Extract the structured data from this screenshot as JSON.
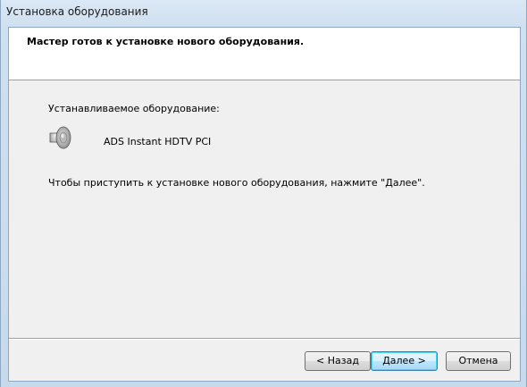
{
  "window": {
    "title": "Установка оборудования"
  },
  "header": {
    "title": "Мастер готов к установке нового оборудования."
  },
  "content": {
    "section_label": "Устанавливаемое оборудование:",
    "device": {
      "icon": "speaker-icon",
      "name": "ADS Instant HDTV PCI"
    },
    "instruction": "Чтобы приступить к установке нового оборудования, нажмите \"Далее\"."
  },
  "buttons": {
    "back": "< Назад",
    "next": "Далее >",
    "cancel": "Отмена"
  },
  "colors": {
    "window_frame": "#cfe0ef",
    "client_bg": "#f0f0f0",
    "header_bg": "#ffffff",
    "default_button_border": "#3c7fb1"
  }
}
